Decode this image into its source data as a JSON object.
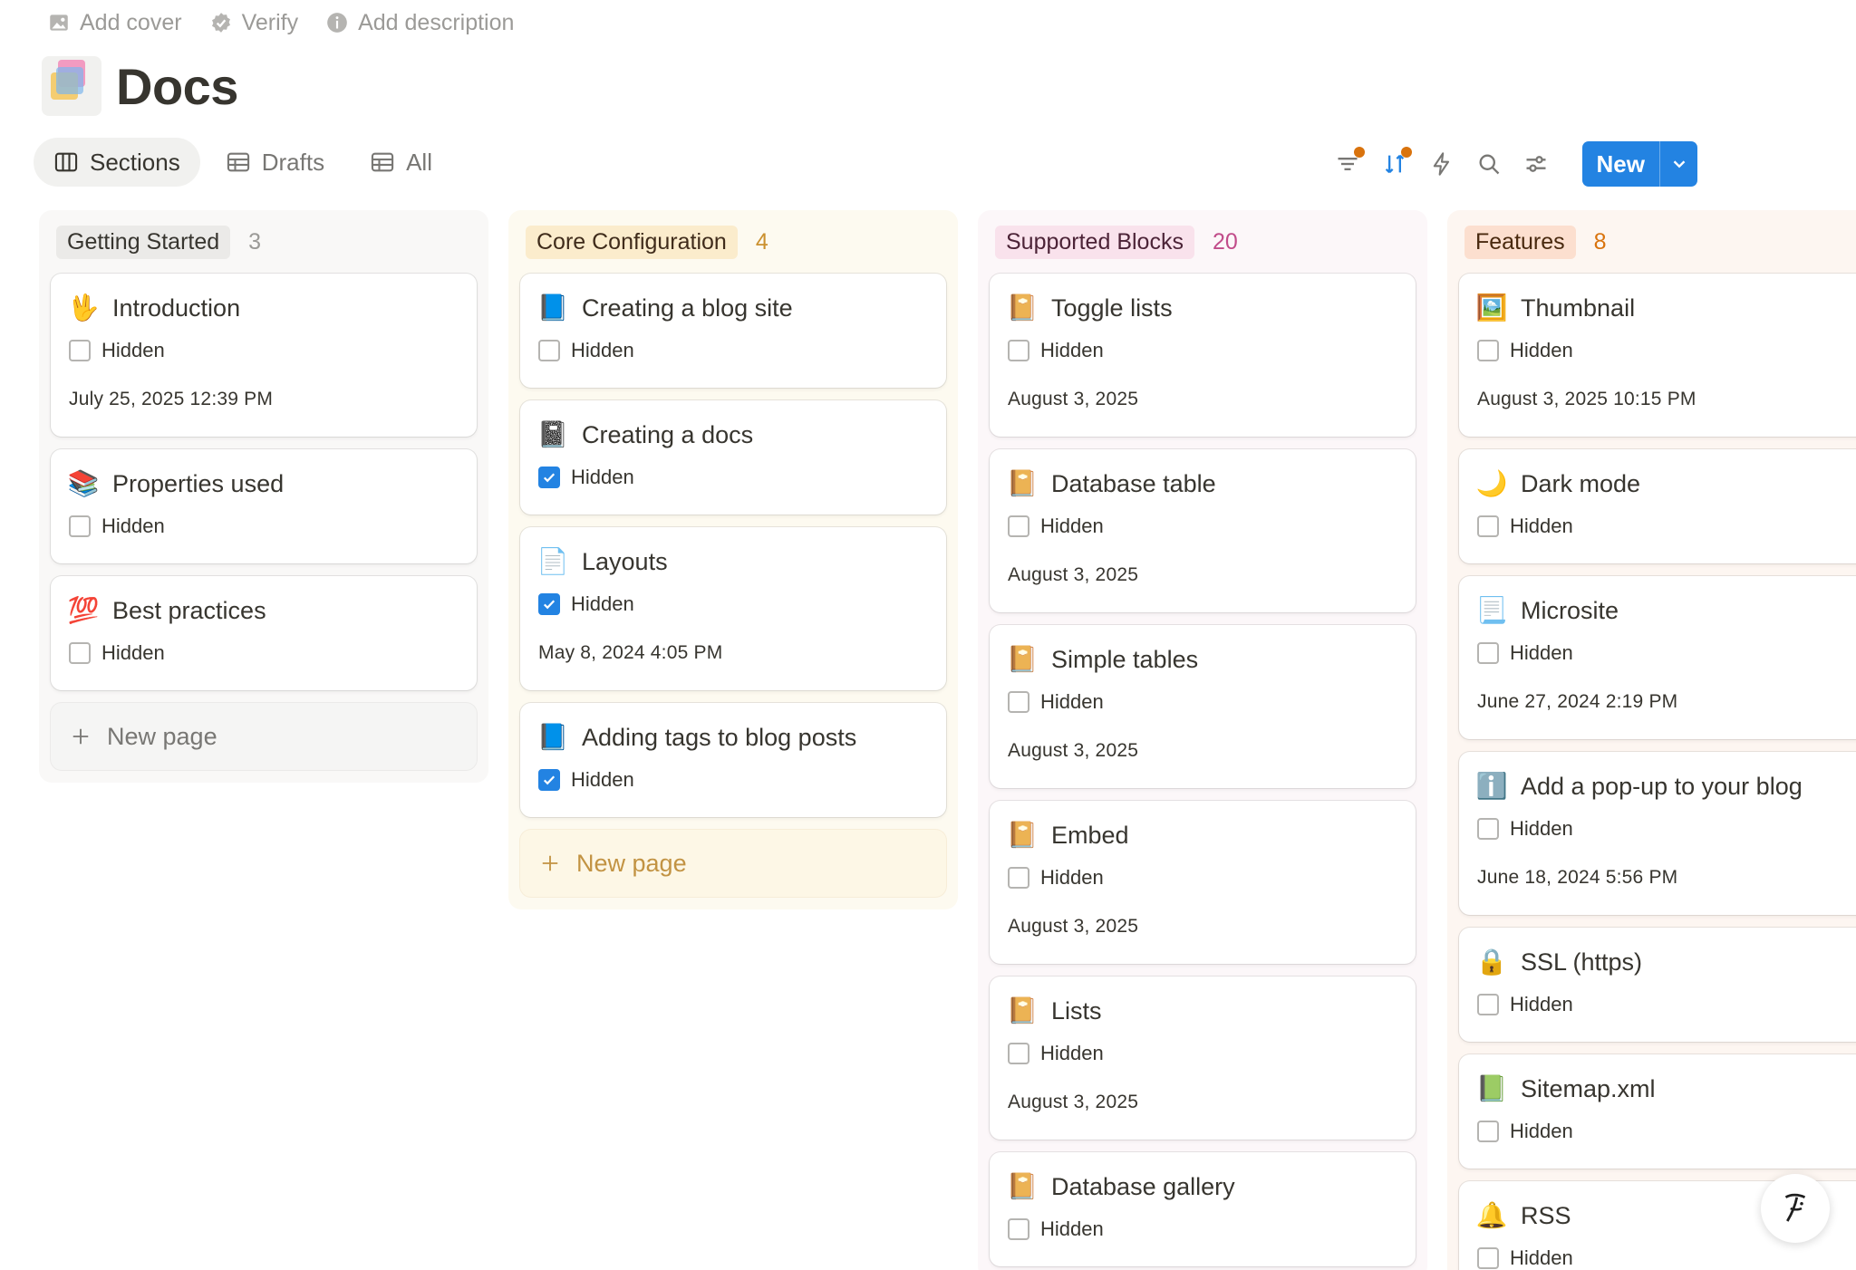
{
  "topbar": {
    "add_cover": "Add cover",
    "verify": "Verify",
    "add_description": "Add description"
  },
  "page": {
    "title": "Docs"
  },
  "views": {
    "sections": "Sections",
    "drafts": "Drafts",
    "all": "All"
  },
  "toolbar": {
    "new_label": "New",
    "icons": [
      "filter-icon",
      "sort-icon",
      "lightning-icon",
      "search-icon",
      "settings-sliders-icon",
      "chevron-down-icon"
    ],
    "accent": "#2383e2",
    "badge_color": "#d9730d"
  },
  "property_label": "Hidden",
  "new_page_label": "New page",
  "columns": [
    {
      "name": "Getting Started",
      "count": "3",
      "cards": [
        {
          "icon": "🖖",
          "title": "Introduction",
          "hidden": false,
          "date": "July 25, 2025 12:39 PM"
        },
        {
          "icon": "📚",
          "title": "Properties used",
          "hidden": false,
          "date": ""
        },
        {
          "icon": "💯",
          "title": "Best practices",
          "hidden": false,
          "date": ""
        }
      ]
    },
    {
      "name": "Core Configuration",
      "count": "4",
      "cards": [
        {
          "icon": "📘",
          "title": "Creating a blog site",
          "hidden": false,
          "date": ""
        },
        {
          "icon": "📓",
          "title": "Creating a docs",
          "hidden": true,
          "date": ""
        },
        {
          "icon": "📄",
          "title": "Layouts",
          "hidden": true,
          "date": "May 8, 2024 4:05 PM"
        },
        {
          "icon": "📘",
          "title": "Adding tags to blog posts",
          "hidden": true,
          "date": ""
        }
      ]
    },
    {
      "name": "Supported Blocks",
      "count": "20",
      "cards": [
        {
          "icon": "📔",
          "title": "Toggle lists",
          "hidden": false,
          "date": "August 3, 2025"
        },
        {
          "icon": "📔",
          "title": "Database table",
          "hidden": false,
          "date": "August 3, 2025"
        },
        {
          "icon": "📔",
          "title": "Simple tables",
          "hidden": false,
          "date": "August 3, 2025"
        },
        {
          "icon": "📔",
          "title": "Embed",
          "hidden": false,
          "date": "August 3, 2025"
        },
        {
          "icon": "📔",
          "title": "Lists",
          "hidden": false,
          "date": "August 3, 2025"
        },
        {
          "icon": "📔",
          "title": "Database gallery",
          "hidden": false,
          "date": ""
        }
      ]
    },
    {
      "name": "Features",
      "count": "8",
      "cards": [
        {
          "icon": "🖼️",
          "title": "Thumbnail",
          "hidden": false,
          "date": "August 3, 2025 10:15 PM"
        },
        {
          "icon": "🌙",
          "title": "Dark mode",
          "hidden": false,
          "date": ""
        },
        {
          "icon": "📃",
          "title": "Microsite",
          "hidden": false,
          "date": "June 27, 2024 2:19 PM"
        },
        {
          "icon": "ℹ️",
          "title": "Add a pop-up to your blog",
          "hidden": false,
          "date": "June 18, 2024 5:56 PM"
        },
        {
          "icon": "🔒",
          "title": "SSL (https)",
          "hidden": false,
          "date": ""
        },
        {
          "icon": "📗",
          "title": "Sitemap.xml",
          "hidden": false,
          "date": ""
        },
        {
          "icon": "🔔",
          "title": "RSS",
          "hidden": false,
          "date": ""
        }
      ]
    }
  ]
}
